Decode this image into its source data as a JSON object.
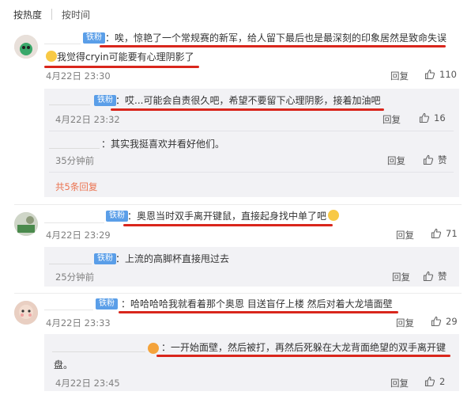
{
  "sortbar": {
    "hot": "按热度",
    "time": "按时间"
  },
  "badge_label": "铁粉",
  "reply_label": "回复",
  "like_label": "赞",
  "comments": [
    {
      "text1": "：唉，惊艳了一个常规赛的新军，给人留下最后也是最深刻的印象居然是致命失误",
      "text2": "我觉得cryin可能要有心理阴影了",
      "time": "4月22日 23:30",
      "likes": "110",
      "replies": [
        {
          "text": "：哎...可能会自责很久吧，希望不要留下心理阴影，接着加油吧",
          "time": "4月22日 23:32",
          "likes": "16"
        },
        {
          "text": "：其实我挺喜欢并看好他们。",
          "time": "35分钟前",
          "likes": "赞"
        }
      ],
      "more": "共5条回复"
    },
    {
      "text1": "：奥恩当时双手离开键鼠，直接起身找中单了吧",
      "time": "4月22日 23:29",
      "likes": "71",
      "replies": [
        {
          "text": "：上流的高脚杯直接甩过去",
          "time": "25分钟前",
          "likes": "赞"
        }
      ]
    },
    {
      "text1": "：哈哈哈哈我就看着那个奥恩 目送盲仔上楼 然后对着大龙墙面壁",
      "time": "4月22日 23:33",
      "likes": "29",
      "replies": [
        {
          "text": "：一开始面壁，然后被打，再然后死躲在大龙背面绝望的双手离开键",
          "text2": "盘。",
          "time": "4月22日 23:45",
          "likes": "2"
        }
      ]
    }
  ]
}
